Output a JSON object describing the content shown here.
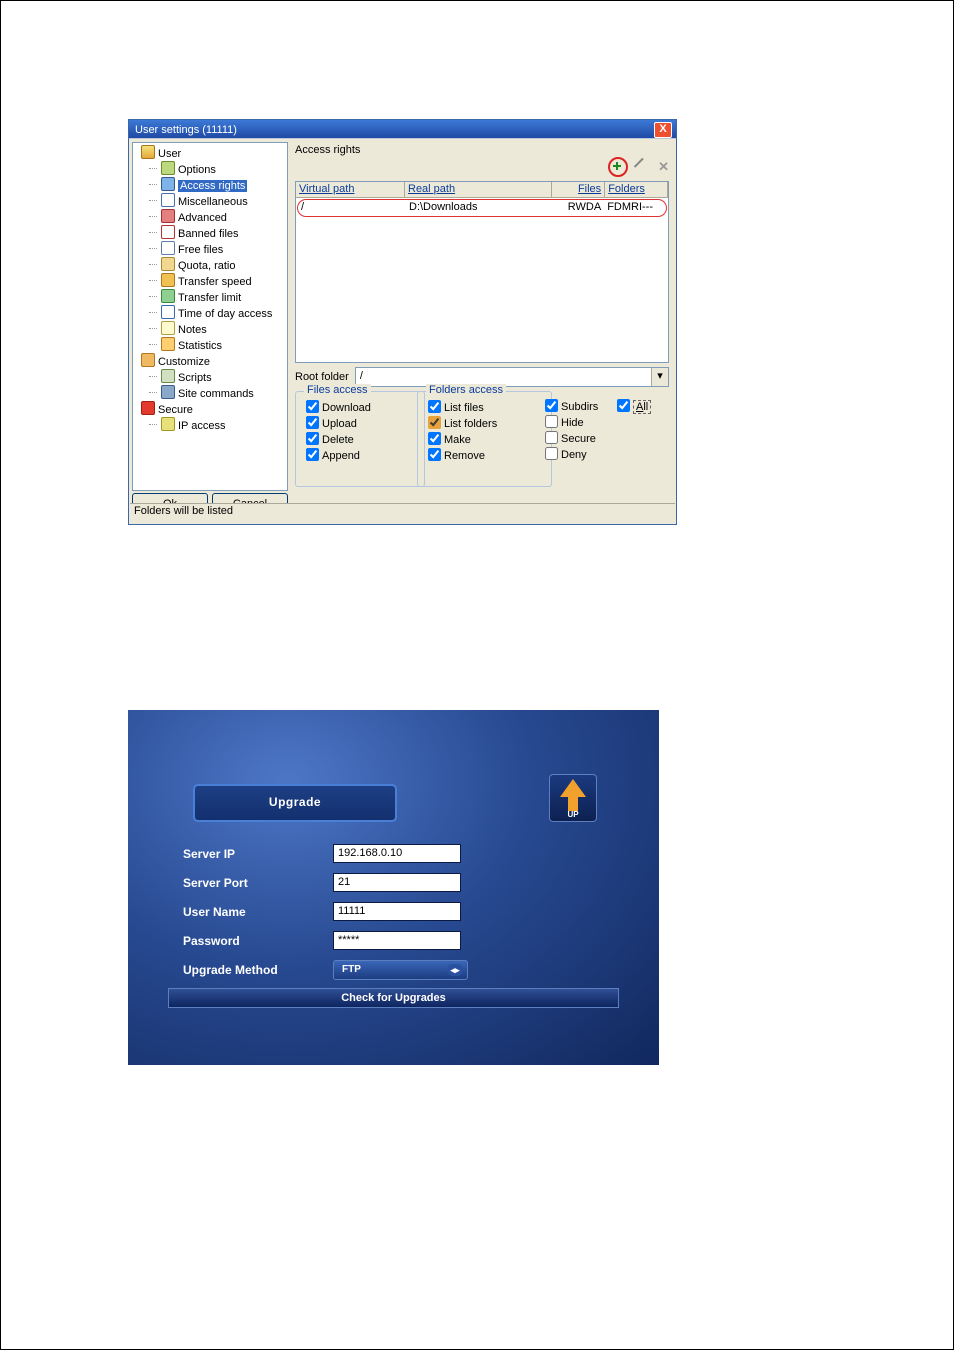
{
  "win1": {
    "title": "User settings (11111)",
    "close": "X",
    "tree": {
      "root": "User",
      "items": [
        "Options",
        "Access rights",
        "Miscellaneous",
        "Advanced",
        "Banned files",
        "Free files",
        "Quota, ratio",
        "Transfer speed",
        "Transfer limit",
        "Time of day access",
        "Notes",
        "Statistics"
      ],
      "customize": "Customize",
      "cust_items": [
        "Scripts",
        "Site commands"
      ],
      "secure": "Secure",
      "sec_items": [
        "IP access"
      ]
    },
    "buttons": {
      "ok": "Ok",
      "cancel": "Cancel"
    },
    "right": {
      "section_label": "Access rights",
      "headers": {
        "vp": "Virtual path",
        "rp": "Real path",
        "files": "Files",
        "folders": "Folders"
      },
      "row": {
        "vp": "/",
        "rp": "D:\\Downloads",
        "files": "RWDA",
        "folders": "FDMRI---"
      },
      "root_label": "Root folder",
      "root_value": "/",
      "grp1_title": "Files access",
      "grp1": {
        "download": "Download",
        "upload": "Upload",
        "delete": "Delete",
        "append": "Append"
      },
      "grp2_title": "Folders access",
      "grp2": {
        "listfiles": "List files",
        "listfolders": "List folders",
        "make": "Make",
        "remove": "Remove"
      },
      "col3": {
        "subdirs": "Subdirs",
        "hide": "Hide",
        "secure": "Secure",
        "deny": "Deny"
      },
      "all": "All"
    },
    "status": "Folders will be listed"
  },
  "win2": {
    "upgrade_btn": "Upgrade",
    "up_icon_label": "UP",
    "rows": {
      "server_ip": {
        "label": "Server IP",
        "value": "192.168.0.10"
      },
      "server_port": {
        "label": "Server Port",
        "value": "21"
      },
      "user_name": {
        "label": "User Name",
        "value": "11111"
      },
      "password": {
        "label": "Password",
        "value": "*****"
      },
      "method": {
        "label": "Upgrade Method",
        "value": "FTP"
      }
    },
    "check_btn": "Check for Upgrades"
  }
}
